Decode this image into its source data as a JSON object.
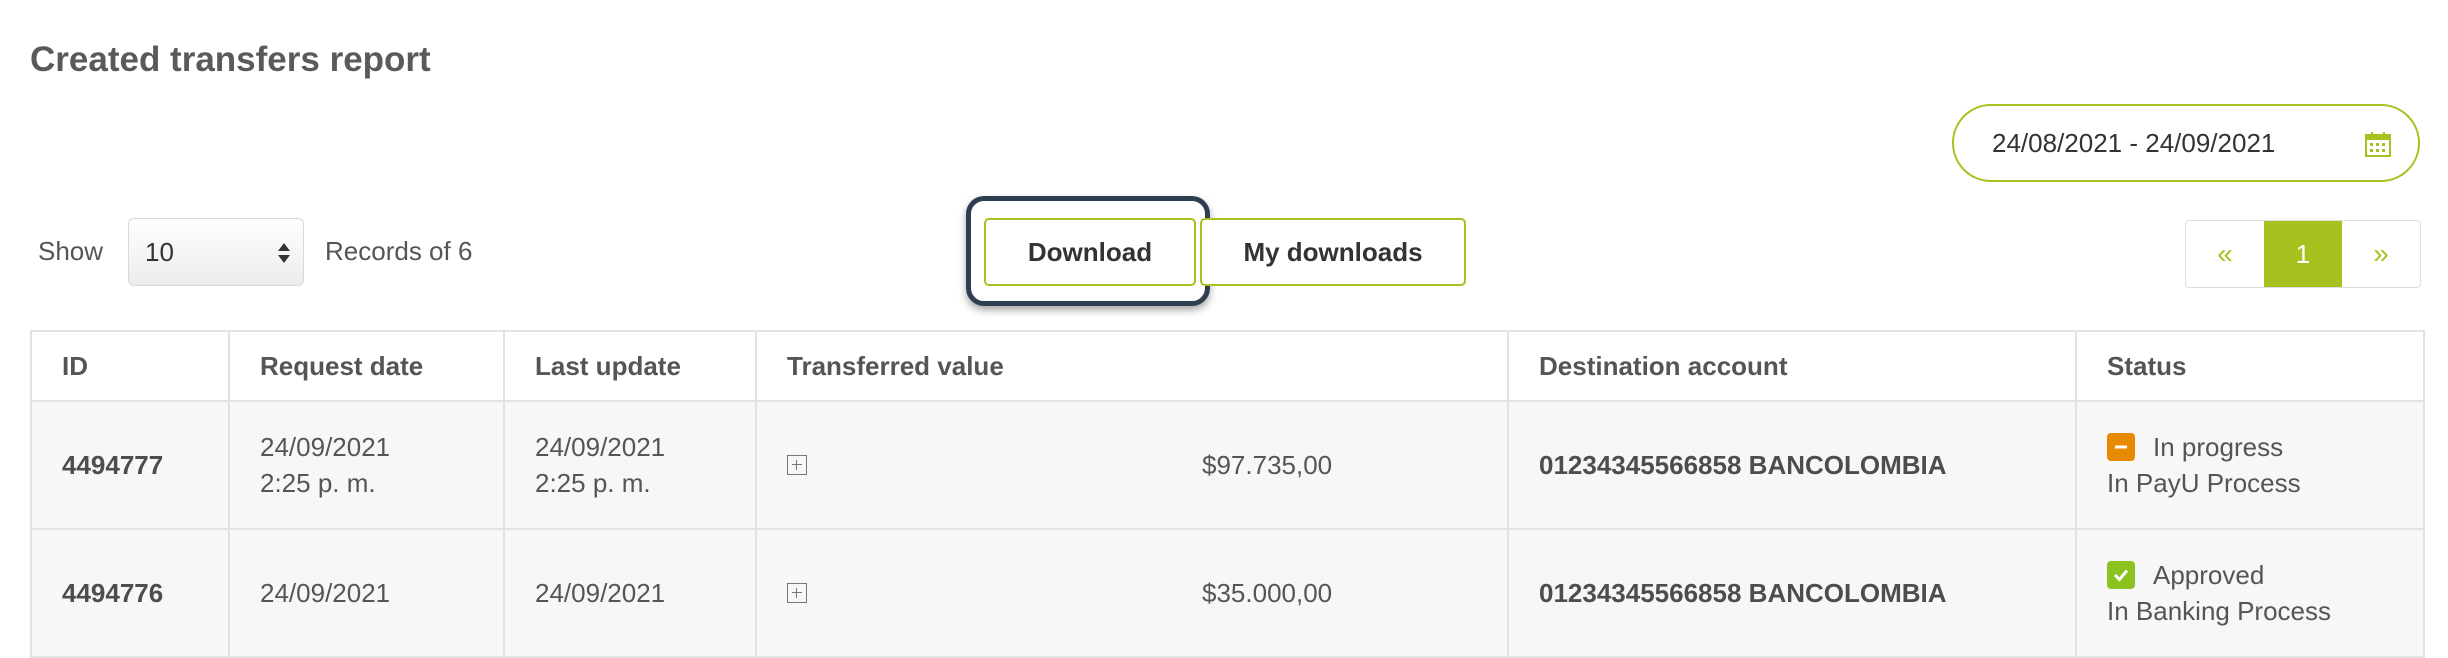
{
  "page": {
    "title": "Created transfers report"
  },
  "filters": {
    "date_range": "24/08/2021 - 24/09/2021",
    "show_label": "Show",
    "page_size": "10",
    "records_text": "Records of 6"
  },
  "actions": {
    "download": "Download",
    "my_downloads": "My downloads"
  },
  "pagination": {
    "prev": "«",
    "current": "1",
    "next": "»"
  },
  "table": {
    "headers": [
      "ID",
      "Request date",
      "Last update",
      "Transferred value",
      "Destination account",
      "Status"
    ],
    "rows": [
      {
        "id": "4494777",
        "request_date": "24/09/2021",
        "request_time": "2:25 p. m.",
        "last_update_date": "24/09/2021",
        "last_update_time": "2:25 p. m.",
        "value": "$97.735,00",
        "account": "01234345566858 BANCOLOMBIA",
        "status": "In progress",
        "status_detail": "In PayU Process",
        "status_icon": "minus-icon"
      },
      {
        "id": "4494776",
        "request_date": "24/09/2021",
        "request_time": "",
        "last_update_date": "24/09/2021",
        "last_update_time": "",
        "value": "$35.000,00",
        "account": "01234345566858 BANCOLOMBIA",
        "status": "Approved",
        "status_detail": "In Banking Process",
        "status_icon": "check-icon"
      }
    ]
  },
  "colors": {
    "accent": "#a5c21f",
    "in_progress": "#e88a00",
    "approved": "#8bc21f",
    "focus": "#2c3e50"
  }
}
